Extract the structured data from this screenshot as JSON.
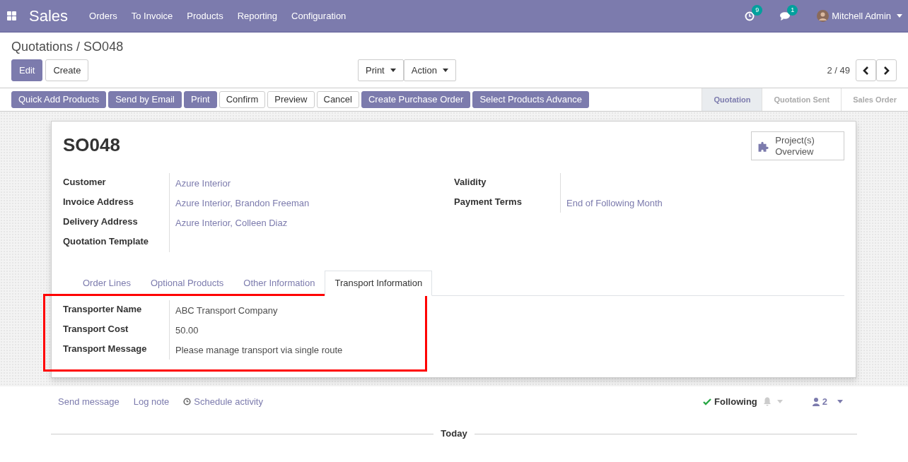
{
  "navbar": {
    "app": "Sales",
    "menus": [
      "Orders",
      "To Invoice",
      "Products",
      "Reporting",
      "Configuration"
    ],
    "activity_count": "9",
    "message_count": "1",
    "user": "Mitchell Admin"
  },
  "breadcrumb": {
    "parent": "Quotations",
    "separator": "/",
    "current": "SO048"
  },
  "buttons": [
    {
      "label": "Edit",
      "kind": "primary"
    },
    {
      "label": "Create",
      "kind": "secondary"
    }
  ],
  "dropdowns": [
    "Print",
    "Action"
  ],
  "pager": "2 / 49",
  "actions": [
    {
      "label": "Quick Add Products",
      "kind": "primary"
    },
    {
      "label": "Send by Email",
      "kind": "primary"
    },
    {
      "label": "Print",
      "kind": "primary"
    },
    {
      "label": "Confirm",
      "kind": "secondary"
    },
    {
      "label": "Preview",
      "kind": "secondary"
    },
    {
      "label": "Cancel",
      "kind": "secondary"
    },
    {
      "label": "Create Purchase Order",
      "kind": "primary"
    },
    {
      "label": "Select Products Advance",
      "kind": "primary"
    }
  ],
  "stages": [
    {
      "label": "Quotation",
      "selected": true
    },
    {
      "label": "Quotation Sent",
      "selected": false
    },
    {
      "label": "Sales Order",
      "selected": false
    }
  ],
  "record": {
    "name": "SO048",
    "smart_button": "Project(s) Overview",
    "left_fields": [
      {
        "label": "Customer",
        "value": "Azure Interior"
      },
      {
        "label": "Invoice Address",
        "value": "Azure Interior, Brandon Freeman"
      },
      {
        "label": "Delivery Address",
        "value": "Azure Interior, Colleen Diaz"
      },
      {
        "label": "Quotation Template"
      }
    ],
    "right_fields": [
      {
        "label": "Validity"
      },
      {
        "label": "Payment Terms",
        "value": "End of Following Month"
      }
    ]
  },
  "tabs": [
    {
      "label": "Order Lines",
      "selected": false
    },
    {
      "label": "Optional Products",
      "selected": false
    },
    {
      "label": "Other Information",
      "selected": false
    },
    {
      "label": "Transport Information",
      "selected": true
    }
  ],
  "transport": {
    "highlighted": true,
    "fields": [
      {
        "label": "Transporter Name",
        "value": "ABC Transport Company"
      },
      {
        "label": "Transport Cost",
        "value": "50.00"
      },
      {
        "label": "Transport Message",
        "value": "Please manage transport via single route"
      }
    ]
  },
  "chatter": {
    "links": [
      {
        "label": "Send message",
        "kind": "plain"
      },
      {
        "label": "Log note",
        "kind": "plain"
      },
      {
        "label": "Schedule activity",
        "kind": "clock"
      }
    ],
    "following": "Following",
    "followers": "2",
    "divider": "Today"
  }
}
